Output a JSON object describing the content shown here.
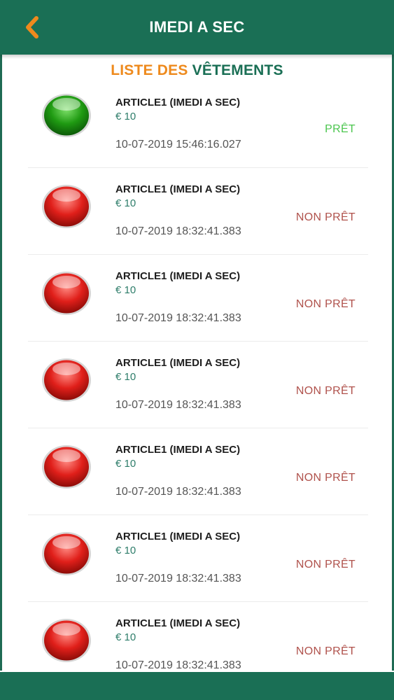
{
  "header": {
    "title": "IMEDI A SEC",
    "back_icon": "chevron-left-icon"
  },
  "section": {
    "title_part1": "LISTE DES",
    "title_part2": "VÊTEMENTS"
  },
  "colors": {
    "header_bg": "#1a6f55",
    "accent_orange": "#ee8a1d",
    "ready": "#4cc64f",
    "not_ready": "#b0524c"
  },
  "items": [
    {
      "name": "ARTICLE1 (IMEDI A SEC)",
      "price": "€ 10",
      "date": "10-07-2019 15:46:16.027",
      "status": "PRÊT",
      "state": "ready",
      "icon": "green-status-icon"
    },
    {
      "name": "ARTICLE1 (IMEDI A SEC)",
      "price": "€ 10",
      "date": "10-07-2019 18:32:41.383",
      "status": "NON PRÊT",
      "state": "not-ready",
      "icon": "red-status-icon"
    },
    {
      "name": "ARTICLE1 (IMEDI A SEC)",
      "price": "€ 10",
      "date": "10-07-2019 18:32:41.383",
      "status": "NON PRÊT",
      "state": "not-ready",
      "icon": "red-status-icon"
    },
    {
      "name": "ARTICLE1 (IMEDI A SEC)",
      "price": "€ 10",
      "date": "10-07-2019 18:32:41.383",
      "status": "NON PRÊT",
      "state": "not-ready",
      "icon": "red-status-icon"
    },
    {
      "name": "ARTICLE1 (IMEDI A SEC)",
      "price": "€ 10",
      "date": "10-07-2019 18:32:41.383",
      "status": "NON PRÊT",
      "state": "not-ready",
      "icon": "red-status-icon"
    },
    {
      "name": "ARTICLE1 (IMEDI A SEC)",
      "price": "€ 10",
      "date": "10-07-2019 18:32:41.383",
      "status": "NON PRÊT",
      "state": "not-ready",
      "icon": "red-status-icon"
    },
    {
      "name": "ARTICLE1 (IMEDI A SEC)",
      "price": "€ 10",
      "date": "10-07-2019 18:32:41.383",
      "status": "NON PRÊT",
      "state": "not-ready",
      "icon": "red-status-icon"
    }
  ]
}
